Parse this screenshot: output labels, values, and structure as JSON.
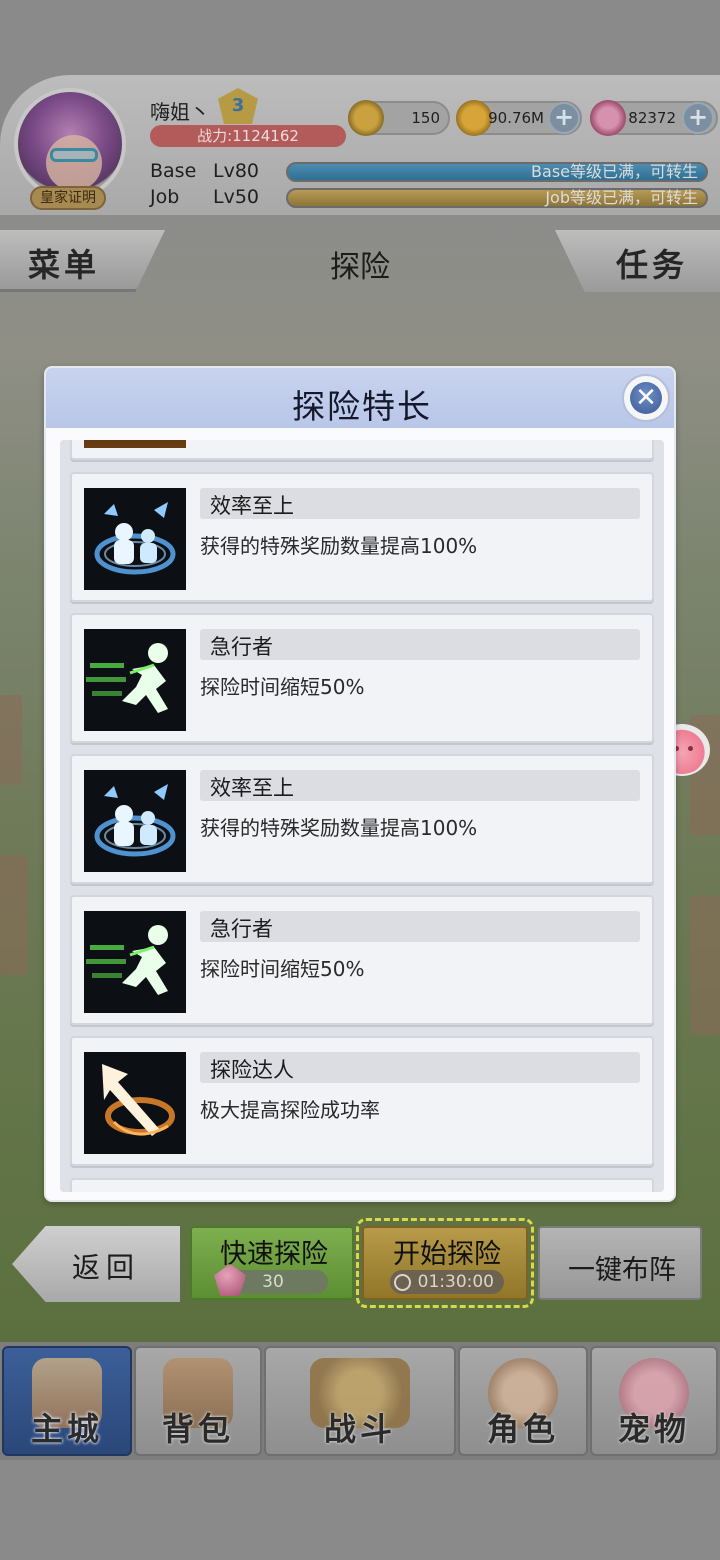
{
  "player": {
    "name": "嗨姐丶",
    "level_badge": "3",
    "title_badge": "皇家证明",
    "power": "战力:1124162",
    "base_label": "Base",
    "base_level": "Lv80",
    "base_status": "Base等级已满，可转生",
    "job_label": "Job",
    "job_level": "Lv50",
    "job_status": "Job等级已满，可转生"
  },
  "currencies": {
    "coin": "150",
    "gold": "90.76M",
    "gem": "82372"
  },
  "top_tabs": {
    "menu": "菜单",
    "current": "探险",
    "tasks": "任务"
  },
  "modal": {
    "title": "探险特长",
    "skills": [
      {
        "name": "效率至上",
        "desc": "获得的特殊奖励数量提高100%",
        "icon": "efficiency-icon"
      },
      {
        "name": "急行者",
        "desc": "探险时间缩短50%",
        "icon": "runner-icon"
      },
      {
        "name": "效率至上",
        "desc": "获得的特殊奖励数量提高100%",
        "icon": "efficiency-icon"
      },
      {
        "name": "急行者",
        "desc": "探险时间缩短50%",
        "icon": "runner-icon"
      },
      {
        "name": "探险达人",
        "desc": "极大提高探险成功率",
        "icon": "explorer-arrow-icon"
      }
    ]
  },
  "actions": {
    "back": "返回",
    "quick": "快速探险",
    "quick_cost": "30",
    "start": "开始探险",
    "start_time": "01:30:00",
    "formation": "一键布阵"
  },
  "nav": {
    "city": "主城",
    "bag": "背包",
    "battle": "战斗",
    "role": "角色",
    "pet": "宠物"
  },
  "colors": {
    "modal_header": "#c8d3ee",
    "quick_button": "#6d9f41",
    "start_button": "#a58a38",
    "nav_active": "#345488"
  }
}
